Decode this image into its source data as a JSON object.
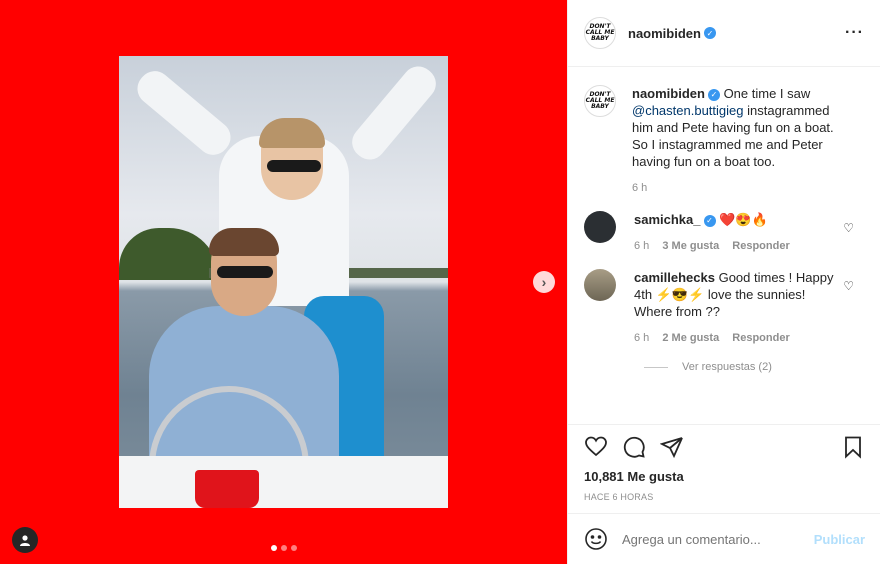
{
  "post": {
    "username": "naomibiden",
    "avatar_text": "DON'T CALL ME BABY",
    "more_icon": "ellipsis-icon"
  },
  "caption": {
    "username": "naomibiden",
    "text_before": " One time I saw ",
    "mention": "@chasten.buttigieg",
    "text_after": " instagrammed him and Pete having fun on a boat. So I instagrammed me and Peter having fun on a boat too.",
    "time": "6 h"
  },
  "comments": [
    {
      "username": "samichka_",
      "text": "❤️😍🔥",
      "time": "6 h",
      "likes": "3 Me gusta",
      "reply": "Responder",
      "avatar_color": "#2b2f33"
    },
    {
      "username": "camillehecks",
      "text": "Good times ! Happy 4th ⚡😎⚡ love the sunnies! Where from ??",
      "time": "6 h",
      "likes": "2 Me gusta",
      "reply": "Responder",
      "avatar_color": "#8b7f6a"
    }
  ],
  "view_replies": "Ver respuestas (2)",
  "likes_count": "10,881 Me gusta",
  "timestamp": "HACE 6 HORAS",
  "comment_box": {
    "placeholder": "Agrega un comentario...",
    "post_label": "Publicar"
  },
  "carousel": {
    "next_icon": "chevron-right-icon",
    "current": 1,
    "total": 3
  },
  "colors": {
    "background": "#ff0000",
    "verified": "#3897f0",
    "heart": "#ed4956"
  }
}
